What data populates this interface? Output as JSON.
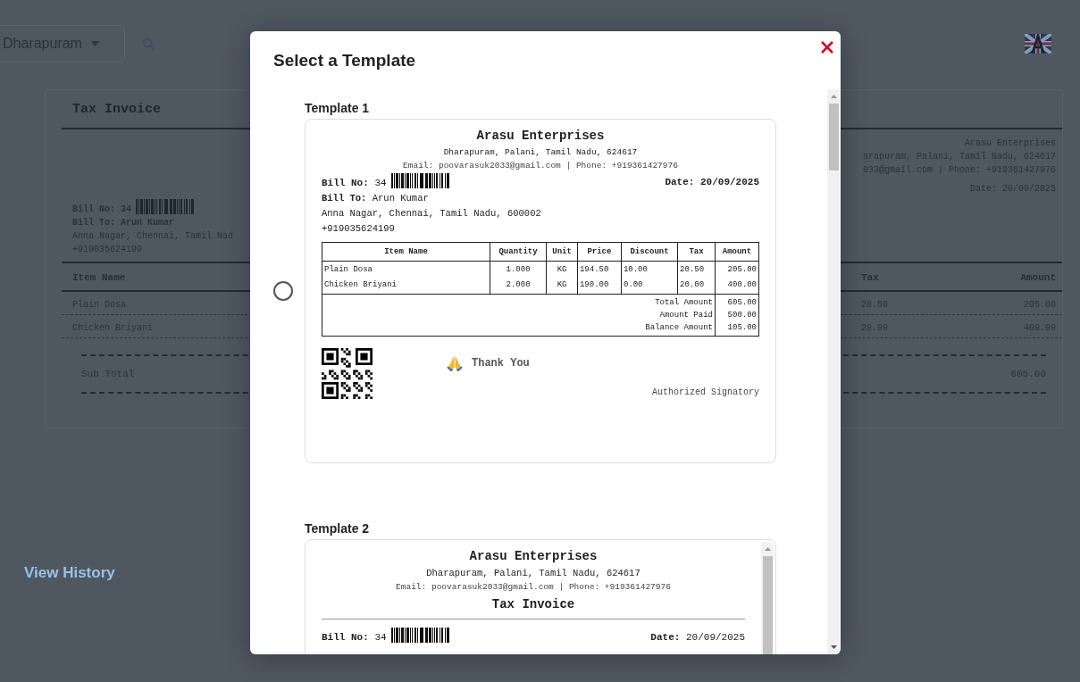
{
  "background": {
    "location_select": "Dharapuram",
    "invoice": {
      "title": "Tax Invoice",
      "company": "Arasu Enterprises",
      "company_address": "arapuram, Palani, Tamil Nadu, 624617",
      "company_contact": "033@gmail.com | Phone: +919361427976",
      "date": "Date: 20/09/2025",
      "bill_no": "Bill No: 34",
      "bill_to": "Bill To: Arun Kumar",
      "customer_address": "Anna Nagar, Chennai, Tamil Nad",
      "customer_phone": "+919035624199",
      "columns": [
        "Item Name",
        "Tax",
        "Amount"
      ],
      "rows": [
        {
          "item": "Plain Dosa",
          "tax": "20.50",
          "amount": "205.00"
        },
        {
          "item": "Chicken Briyani",
          "tax": "20.00",
          "amount": "400.00"
        }
      ],
      "subtotal_label": "Sub Total",
      "subtotal_value": "605.00"
    },
    "view_history": "View History"
  },
  "modal": {
    "title": "Select a Template",
    "templates": [
      {
        "label": "Template 1",
        "kind": "card",
        "selected": false,
        "invoice": {
          "company": "Arasu Enterprises",
          "address": "Dharapuram, Palani, Tamil Nadu, 624617",
          "contact": "Email: poovarasuk2033@gmail.com | Phone: +919361427976",
          "bill_no": "**Bill No:** 34",
          "date": "**Date: 20/09/2025**",
          "bill_to": "**Bill To:** Arun Kumar",
          "customer_address": "Anna Nagar, Chennai, Tamil Nadu, 600002",
          "customer_phone": "+919035624199",
          "table": {
            "columns": [
              "Item Name",
              "Quantity",
              "Unit",
              "Price",
              "Discount",
              "Tax",
              "Amount"
            ],
            "rows": [
              [
                "Plain Dosa",
                "1.000",
                "KG",
                "194.50",
                "10.00",
                "20.50",
                "205.00"
              ],
              [
                "Chicken Briyani",
                "2.000",
                "KG",
                "190.00",
                "0.00",
                "20.00",
                "400.00"
              ]
            ],
            "totals": [
              {
                "label": "Total Amount",
                "value": "605.00"
              },
              {
                "label": "Amount Paid",
                "value": "500.00"
              },
              {
                "label": "Balance Amount",
                "value": "105.00"
              }
            ]
          },
          "thank_you": "Thank You",
          "signatory": "Authorized Signatory"
        }
      },
      {
        "label": "Template 2",
        "kind": "scroll-card",
        "invoice": {
          "company": "Arasu Enterprises",
          "address": "Dharapuram, Palani, Tamil Nadu, 624617",
          "contact": "Email: poovarasuk2033@gmail.com | Phone: +919361427976",
          "title": "Tax Invoice",
          "bill_no": "**Bill No:** 34",
          "date": "**Date:** 20/09/2025"
        }
      }
    ]
  }
}
